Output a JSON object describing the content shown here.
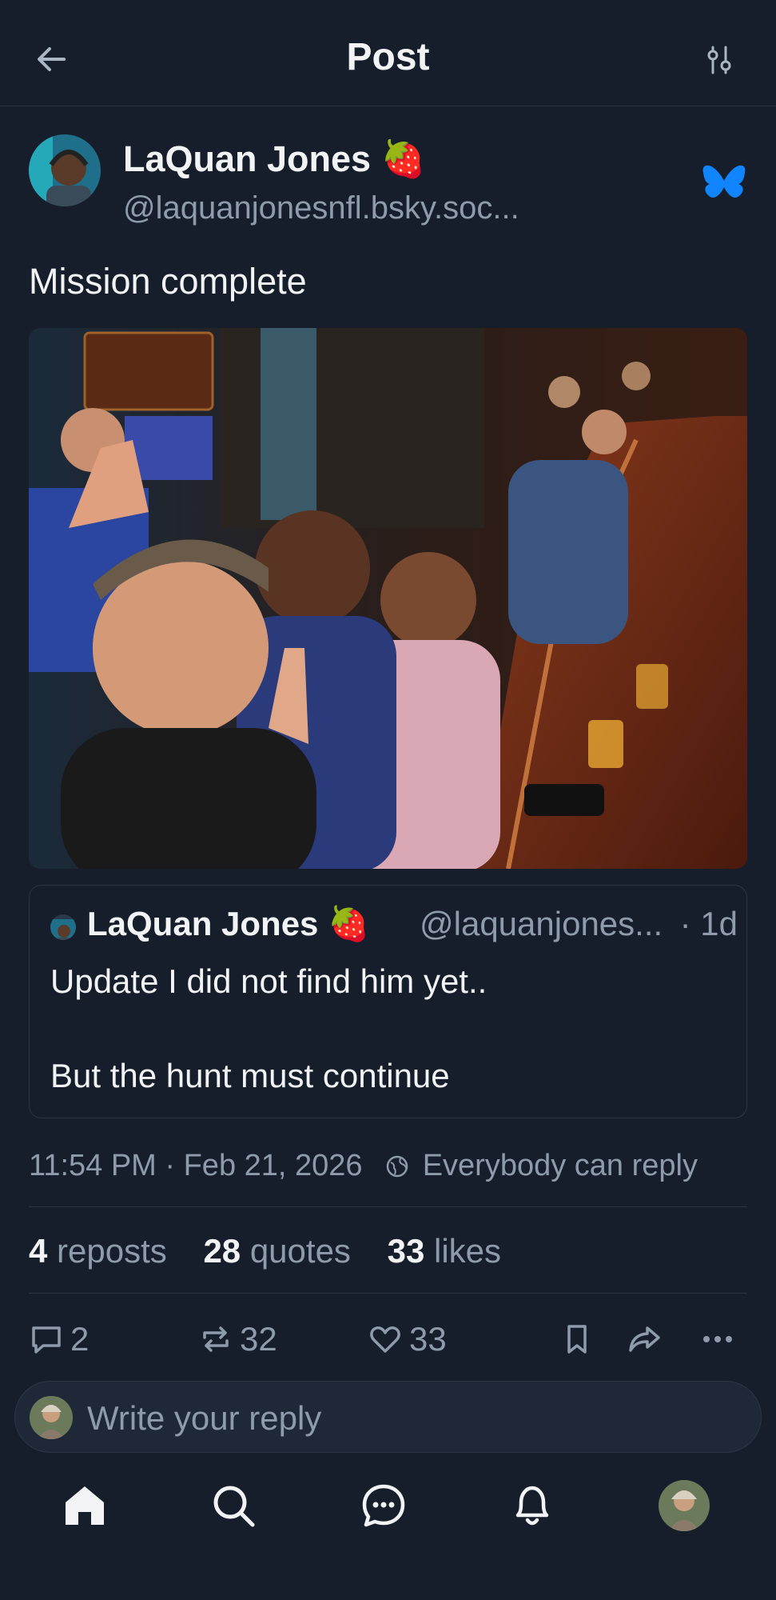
{
  "header": {
    "title": "Post",
    "back_icon": "arrow-left-icon",
    "settings_icon": "sliders-icon"
  },
  "author": {
    "name": "LaQuan Jones",
    "emoji": "🍓",
    "handle": "@laquanjonesnfl.bsky.soc..."
  },
  "post": {
    "text": "Mission complete"
  },
  "quote": {
    "name": "LaQuan Jones",
    "emoji": "🍓",
    "handle": "@laquanjones...",
    "time": "· 1d",
    "line1": "Update I did not find him yet..",
    "line2": "But the hunt must continue"
  },
  "meta": {
    "timestamp": "11:54 PM · Feb 21, 2026",
    "reply_policy": "Everybody can reply"
  },
  "stats": {
    "reposts_count": "4",
    "reposts_label": "reposts",
    "quotes_count": "28",
    "quotes_label": "quotes",
    "likes_count": "33",
    "likes_label": "likes"
  },
  "actions": {
    "replies": "2",
    "reposts": "32",
    "likes": "33"
  },
  "reply_bar": {
    "placeholder": "Write your reply"
  },
  "colors": {
    "background": "#161e2b",
    "accent": "#1185fe",
    "muted": "#8d9bab",
    "border": "#2b3644"
  }
}
